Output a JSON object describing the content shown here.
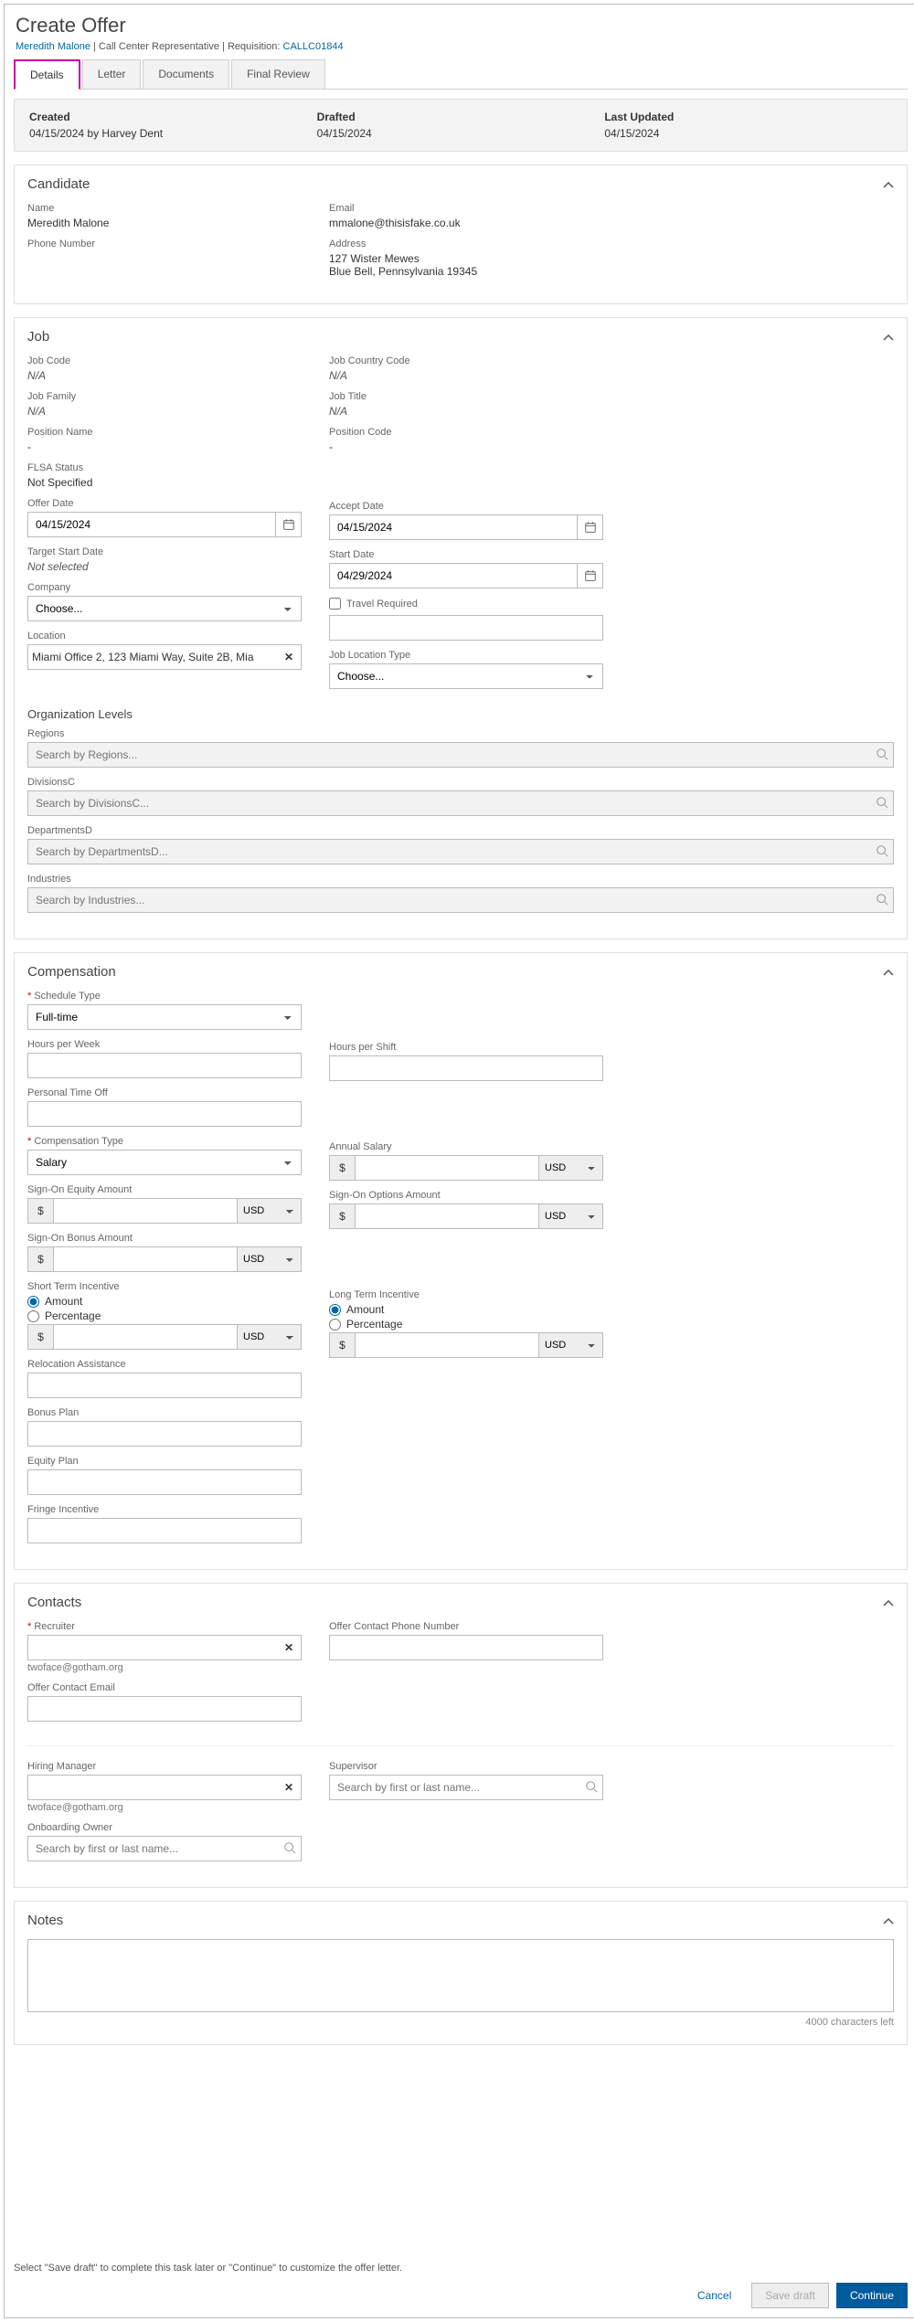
{
  "page": {
    "title": "Create Offer"
  },
  "breadcrumb": {
    "candidate": "Meredith Malone",
    "role": "Call Center Representative",
    "req_label": "Requisition:",
    "req_id": "CALLC01844"
  },
  "tabs": {
    "details": "Details",
    "letter": "Letter",
    "documents": "Documents",
    "final_review": "Final Review"
  },
  "status": {
    "created_label": "Created",
    "created_value": "04/15/2024 by Harvey Dent",
    "drafted_label": "Drafted",
    "drafted_value": "04/15/2024",
    "updated_label": "Last Updated",
    "updated_value": "04/15/2024"
  },
  "candidate": {
    "title": "Candidate",
    "name_label": "Name",
    "name_value": "Meredith Malone",
    "email_label": "Email",
    "email_value": "mmalone@thisisfake.co.uk",
    "phone_label": "Phone Number",
    "address_label": "Address",
    "address_line1": "127 Wister Mewes",
    "address_line2": "Blue Bell, Pennsylvania 19345"
  },
  "job": {
    "title": "Job",
    "code_label": "Job Code",
    "code_value": "N/A",
    "country_label": "Job Country Code",
    "country_value": "N/A",
    "family_label": "Job Family",
    "family_value": "N/A",
    "jtitle_label": "Job Title",
    "jtitle_value": "N/A",
    "posname_label": "Position Name",
    "posname_value": "-",
    "poscode_label": "Position Code",
    "poscode_value": "-",
    "flsa_label": "FLSA Status",
    "flsa_value": "Not Specified",
    "offerdate_label": "Offer Date",
    "offerdate_value": "04/15/2024",
    "acceptdate_label": "Accept Date",
    "acceptdate_value": "04/15/2024",
    "targetstart_label": "Target Start Date",
    "targetstart_value": "Not selected",
    "startdate_label": "Start Date",
    "startdate_value": "04/29/2024",
    "company_label": "Company",
    "company_choose": "Choose...",
    "travel_label": "Travel Required",
    "location_label": "Location",
    "location_value": "Miami Office 2, 123 Miami Way, Suite 2B, Mia",
    "joblocation_label": "Job Location Type",
    "joblocation_choose": "Choose...",
    "org_title": "Organization Levels",
    "regions_label": "Regions",
    "regions_ph": "Search by Regions...",
    "divisions_label": "DivisionsC",
    "divisions_ph": "Search by DivisionsC...",
    "depts_label": "DepartmentsD",
    "depts_ph": "Search by DepartmentsD...",
    "industries_label": "Industries",
    "industries_ph": "Search by Industries..."
  },
  "comp": {
    "title": "Compensation",
    "schedule_label": "Schedule Type",
    "schedule_value": "Full-time",
    "hpw_label": "Hours per Week",
    "hps_label": "Hours per Shift",
    "pto_label": "Personal Time Off",
    "comptype_label": "Compensation Type",
    "comptype_value": "Salary",
    "annual_label": "Annual Salary",
    "equity_label": "Sign-On Equity Amount",
    "options_label": "Sign-On Options Amount",
    "bonus_label": "Sign-On Bonus Amount",
    "sti_label": "Short Term Incentive",
    "lti_label": "Long Term Incentive",
    "amount_label": "Amount",
    "percentage_label": "Percentage",
    "relo_label": "Relocation Assistance",
    "bonusplan_label": "Bonus Plan",
    "equityplan_label": "Equity Plan",
    "fringe_label": "Fringe Incentive",
    "currency_prefix": "$",
    "currency_code": "USD"
  },
  "contacts": {
    "title": "Contacts",
    "recruiter_label": "Recruiter",
    "recruiter_email": "twoface@gotham.org",
    "phone_label": "Offer Contact Phone Number",
    "email_label": "Offer Contact Email",
    "hm_label": "Hiring Manager",
    "hm_email": "twoface@gotham.org",
    "supervisor_label": "Supervisor",
    "supervisor_ph": "Search by first or last name...",
    "owner_label": "Onboarding Owner",
    "owner_ph": "Search by first or last name..."
  },
  "notes": {
    "title": "Notes",
    "counter": "4000 characters left"
  },
  "footer": {
    "hint": "Select \"Save draft\" to complete this task later or \"Continue\" to customize the offer letter.",
    "cancel": "Cancel",
    "save": "Save draft",
    "continue": "Continue"
  }
}
